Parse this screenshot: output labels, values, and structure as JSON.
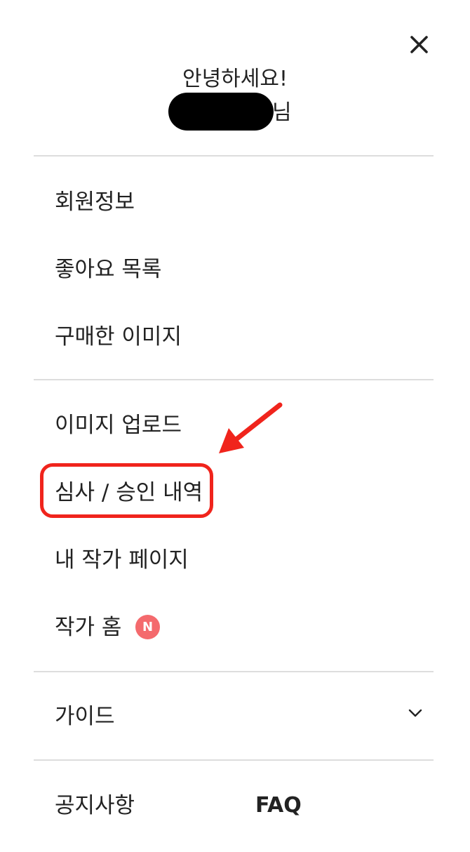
{
  "header": {
    "greeting": "안녕하세요!",
    "name_suffix": "님",
    "close_icon": "close-icon"
  },
  "menu": {
    "account": [
      {
        "label": "회원정보"
      },
      {
        "label": "좋아요 목록"
      },
      {
        "label": "구매한 이미지"
      }
    ],
    "creator": [
      {
        "label": "이미지 업로드"
      },
      {
        "label": "심사 / 승인 내역"
      },
      {
        "label": "내 작가 페이지"
      },
      {
        "label": "작가 홈",
        "badge": "N"
      }
    ],
    "guide": {
      "label": "가이드",
      "icon": "chevron-down-icon"
    },
    "footer": {
      "notice_label": "공지사항",
      "faq_label": "FAQ"
    }
  },
  "colors": {
    "text": "#222222",
    "divider": "#dddddd",
    "badge": "#f46a6d",
    "annotation": "#f0241c"
  }
}
